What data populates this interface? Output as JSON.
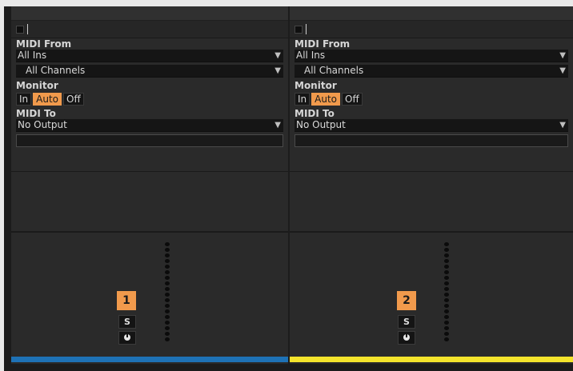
{
  "tracks": [
    {
      "number": "1",
      "color": "#1e72b6",
      "midi_from_label": "MIDI From",
      "midi_from_value": "All Ins",
      "channel_value": "All Channels",
      "monitor_label": "Monitor",
      "monitor_options": [
        "In",
        "Auto",
        "Off"
      ],
      "monitor_selected": "Auto",
      "midi_to_label": "MIDI To",
      "midi_to_value": "No Output",
      "solo_label": "S"
    },
    {
      "number": "2",
      "color": "#f4e42c",
      "midi_from_label": "MIDI From",
      "midi_from_value": "All Ins",
      "channel_value": "All Channels",
      "monitor_label": "Monitor",
      "monitor_options": [
        "In",
        "Auto",
        "Off"
      ],
      "monitor_selected": "Auto",
      "midi_to_label": "MIDI To",
      "midi_to_value": "No Output",
      "solo_label": "S"
    }
  ],
  "icons": {
    "dropdown": "chevron-down-icon",
    "arm": "record-arm-icon",
    "knob": "pan-knob-icon"
  }
}
